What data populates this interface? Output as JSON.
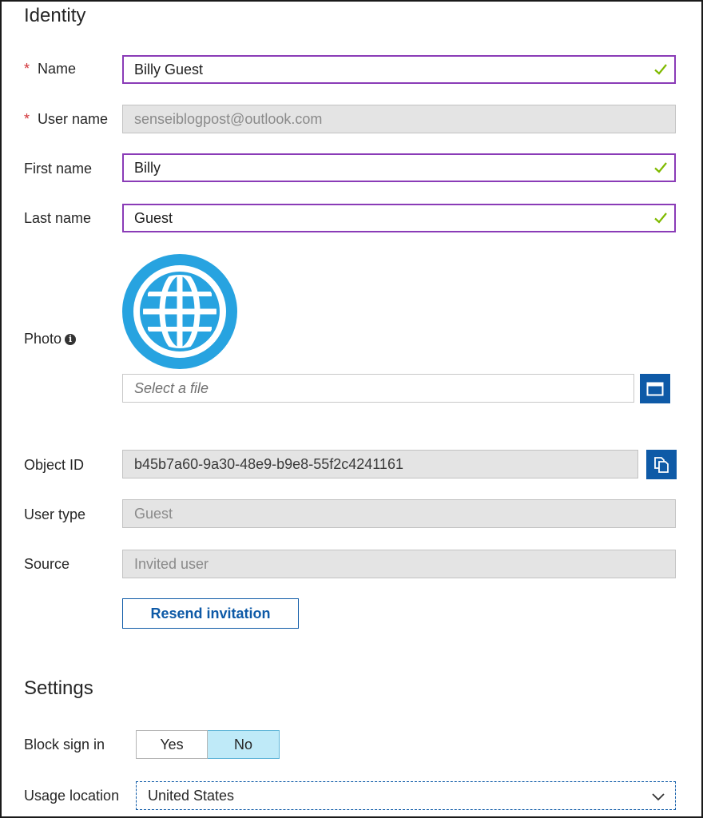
{
  "identity": {
    "title": "Identity",
    "name": {
      "label": "Name",
      "value": "Billy Guest"
    },
    "user_name": {
      "label": "User name",
      "value": "senseiblogpost@outlook.com"
    },
    "first_name": {
      "label": "First name",
      "value": "Billy"
    },
    "last_name": {
      "label": "Last name",
      "value": "Guest"
    },
    "photo": {
      "label": "Photo",
      "placeholder": "Select a file"
    },
    "object_id": {
      "label": "Object ID",
      "value": "b45b7a60-9a30-48e9-b9e8-55f2c4241161"
    },
    "user_type": {
      "label": "User type",
      "value": "Guest"
    },
    "source": {
      "label": "Source",
      "value": "Invited user"
    },
    "resend_label": "Resend invitation"
  },
  "settings": {
    "title": "Settings",
    "block_sign_in": {
      "label": "Block sign in",
      "yes": "Yes",
      "no": "No",
      "selected": "No"
    },
    "usage_location": {
      "label": "Usage location",
      "value": "United States"
    }
  },
  "icons": {
    "required": "asterisk",
    "valid": "checkmark-icon",
    "info": "info-icon",
    "browse": "folder-icon",
    "copy": "copy-icon",
    "avatar": "globe-icon",
    "dropdown": "chevron-down-icon"
  },
  "colors": {
    "accent": "#0e5aa7",
    "valid_border": "#8a3bb7",
    "check": "#7fba00",
    "required": "#d13438",
    "toggle_selected": "#bfeaf8",
    "globe": "#27a3e0"
  }
}
